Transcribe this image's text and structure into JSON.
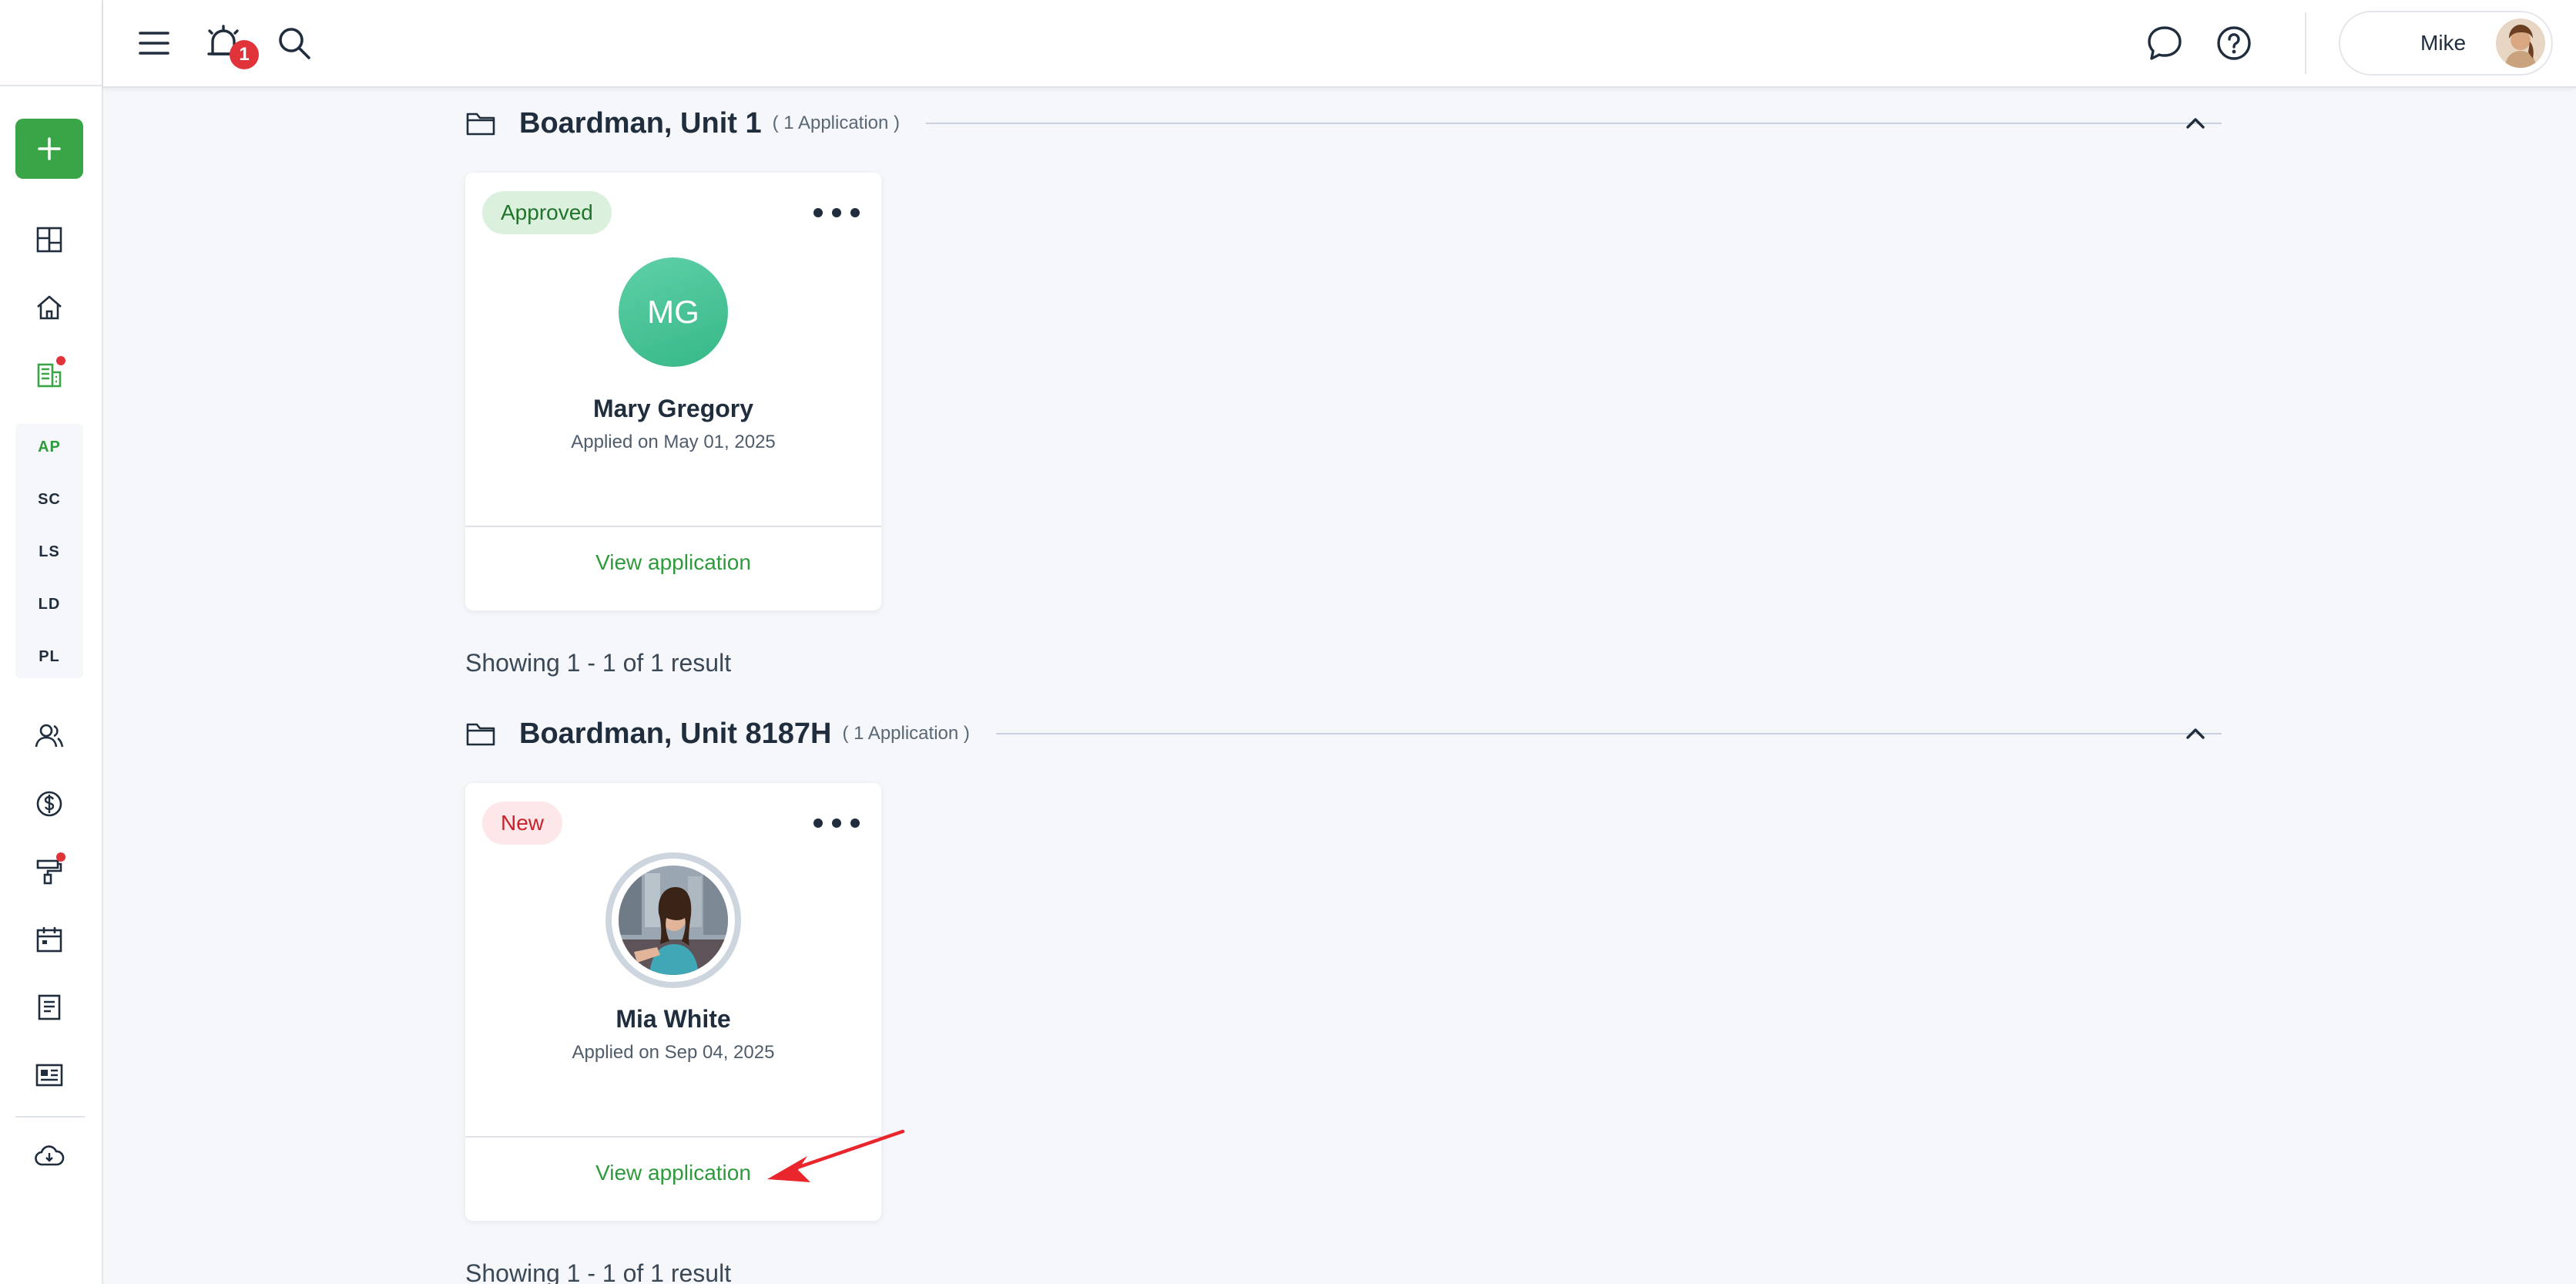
{
  "topbar": {
    "notification_count": "1",
    "user_name": "Mike"
  },
  "sidebar": {
    "sub_items": [
      "AP",
      "SC",
      "LS",
      "LD",
      "PL"
    ]
  },
  "sections": [
    {
      "title": "Boardman, Unit 1",
      "count": "( 1 Application )",
      "card": {
        "status": "Approved",
        "initials": "MG",
        "name": "Mary Gregory",
        "applied": "Applied on May 01, 2025",
        "link": "View application"
      },
      "showing": "Showing 1 - 1 of 1 result"
    },
    {
      "title": "Boardman, Unit 8187H",
      "count": "( 1 Application )",
      "card": {
        "status": "New",
        "name": "Mia White",
        "applied": "Applied on Sep 04, 2025",
        "link": "View application"
      },
      "showing": "Showing 1 - 1 of 1 result"
    }
  ],
  "colors": {
    "accent_green": "#3aa547",
    "link_green": "#2f9a3b",
    "alert_red": "#e0343a",
    "arrow_red": "#e8262b"
  }
}
